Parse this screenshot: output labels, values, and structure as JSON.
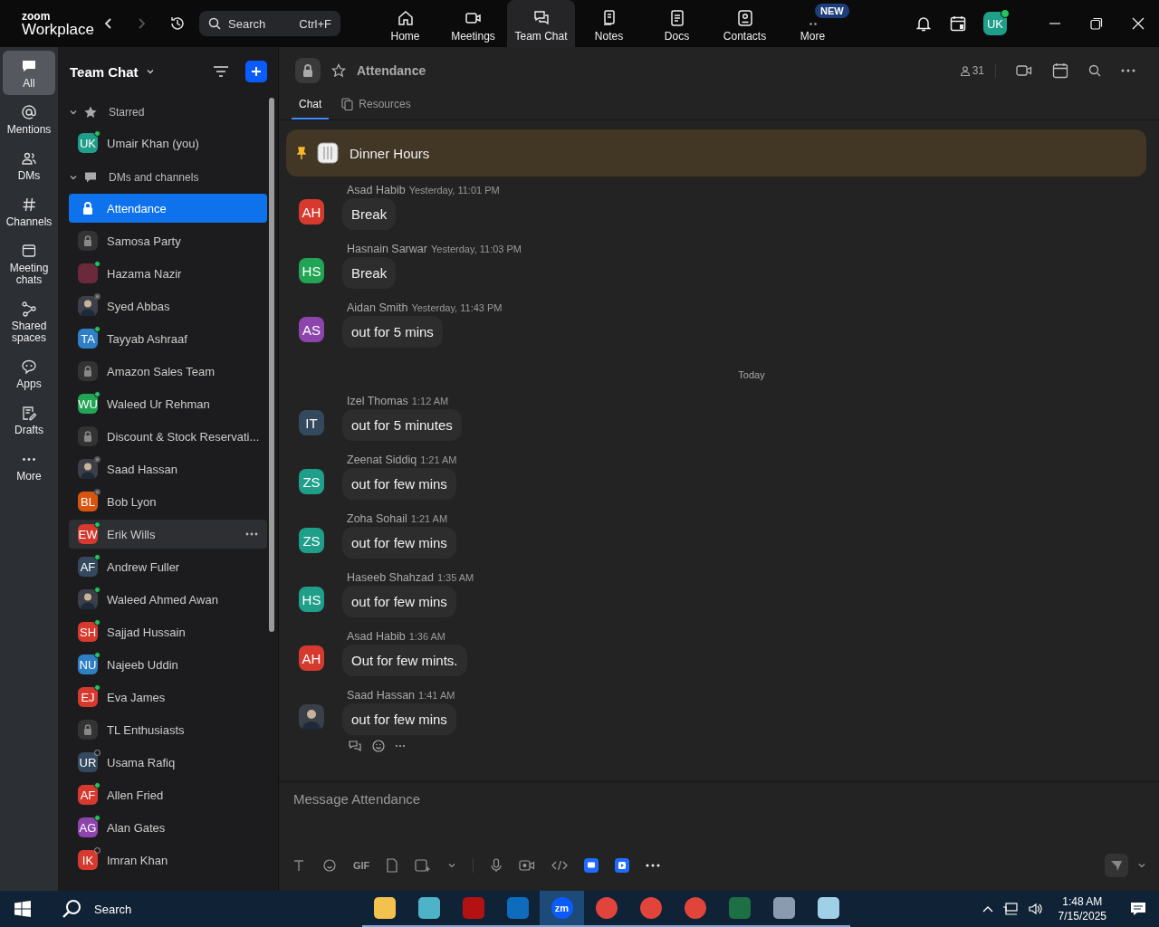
{
  "app": {
    "brand_small": "zoom",
    "brand": "Workplace",
    "search": {
      "placeholder": "Search",
      "shortcut": "Ctrl+F"
    }
  },
  "nav_tabs": [
    {
      "label": "Home",
      "kind": "home",
      "selected": false
    },
    {
      "label": "Meetings",
      "kind": "video",
      "selected": false
    },
    {
      "label": "Team Chat",
      "kind": "chat",
      "selected": true
    },
    {
      "label": "Notes",
      "kind": "notes",
      "selected": false
    },
    {
      "label": "Docs",
      "kind": "doc",
      "selected": false
    },
    {
      "label": "Contacts",
      "kind": "contact",
      "selected": false
    },
    {
      "label": "More",
      "kind": "more",
      "selected": false,
      "badge": "NEW"
    }
  ],
  "user": {
    "initials": "UK",
    "online": true
  },
  "rail": [
    {
      "label": "All",
      "kind": "chat",
      "selected": true
    },
    {
      "label": "Mentions",
      "kind": "at",
      "selected": false
    },
    {
      "label": "DMs",
      "kind": "people",
      "selected": false
    },
    {
      "label": "Channels",
      "kind": "hash",
      "selected": false
    },
    {
      "label": "Meeting chats",
      "kind": "calendar",
      "selected": false
    },
    {
      "label": "Shared spaces",
      "kind": "share",
      "selected": false
    },
    {
      "label": "Apps",
      "kind": "bubble",
      "selected": false
    },
    {
      "label": "Drafts",
      "kind": "draft",
      "selected": false
    },
    {
      "label": "More",
      "kind": "dots",
      "selected": false
    }
  ],
  "sidebar": {
    "title": "Team Chat",
    "sections": [
      {
        "label": "Starred",
        "kind": "star",
        "expanded": true,
        "items": [
          {
            "name": "Umair Khan (you)",
            "kind": "initials",
            "initials": "UK",
            "color": "#1f9e89",
            "online": true,
            "away": false,
            "selected": false,
            "hovered": false
          }
        ]
      },
      {
        "label": "DMs and channels",
        "kind": "bubble",
        "expanded": true,
        "items": [
          {
            "name": "Attendance",
            "kind": "lock",
            "selected": true,
            "hovered": false
          },
          {
            "name": "Samosa Party",
            "kind": "lock",
            "selected": false,
            "hovered": false
          },
          {
            "name": "Hazama Nazir",
            "kind": "initials",
            "color": "#6b2a3c",
            "online": true,
            "away": false,
            "selected": false,
            "hovered": false
          },
          {
            "name": "Syed Abbas",
            "kind": "photo",
            "online": false,
            "away": true,
            "selected": false,
            "hovered": false
          },
          {
            "name": "Tayyab Ashraaf",
            "kind": "initials",
            "initials": "TA",
            "color": "#2f7fc6",
            "online": true,
            "away": false,
            "selected": false,
            "hovered": false
          },
          {
            "name": "Amazon Sales Team",
            "kind": "lock",
            "selected": false,
            "hovered": false
          },
          {
            "name": "Waleed Ur Rehman",
            "kind": "initials",
            "initials": "WU",
            "color": "#22a455",
            "online": true,
            "away": false,
            "selected": false,
            "hovered": false
          },
          {
            "name": "Discount & Stock Reservati...",
            "kind": "lock",
            "selected": false,
            "hovered": false
          },
          {
            "name": "Saad Hassan",
            "kind": "photo",
            "online": false,
            "away": true,
            "selected": false,
            "hovered": false
          },
          {
            "name": "Bob Lyon",
            "kind": "initials",
            "initials": "BL",
            "color": "#d9540f",
            "online": false,
            "away": true,
            "selected": false,
            "hovered": false
          },
          {
            "name": "Erik Wills",
            "kind": "initials",
            "initials": "EW",
            "color": "#d63a2f",
            "online": true,
            "away": false,
            "selected": false,
            "hovered": true
          },
          {
            "name": "Andrew Fuller",
            "kind": "initials",
            "initials": "AF",
            "color": "#34495e",
            "online": true,
            "away": false,
            "selected": false,
            "hovered": false
          },
          {
            "name": "Waleed Ahmed Awan",
            "kind": "photo",
            "online": true,
            "away": false,
            "selected": false,
            "hovered": false
          },
          {
            "name": "Sajjad Hussain",
            "kind": "initials",
            "initials": "SH",
            "color": "#d63a2f",
            "online": true,
            "away": false,
            "selected": false,
            "hovered": false
          },
          {
            "name": "Najeeb Uddin",
            "kind": "initials",
            "initials": "NU",
            "color": "#2f7fc6",
            "online": true,
            "away": false,
            "selected": false,
            "hovered": false
          },
          {
            "name": "Eva James",
            "kind": "initials",
            "initials": "EJ",
            "color": "#d63a2f",
            "online": true,
            "away": false,
            "selected": false,
            "hovered": false
          },
          {
            "name": "TL Enthusiasts",
            "kind": "lock",
            "selected": false,
            "hovered": false
          },
          {
            "name": "Usama Rafiq",
            "kind": "initials",
            "initials": "UR",
            "color": "#34495e",
            "online": false,
            "away": false,
            "selected": false,
            "hovered": false
          },
          {
            "name": "Allen Fried",
            "kind": "initials",
            "initials": "AF",
            "color": "#d63a2f",
            "online": true,
            "away": false,
            "selected": false,
            "hovered": false
          },
          {
            "name": "Alan Gates",
            "kind": "initials",
            "initials": "AG",
            "color": "#8e44ad",
            "online": true,
            "away": false,
            "selected": false,
            "hovered": false
          },
          {
            "name": "Imran Khan",
            "kind": "initials",
            "initials": "IK",
            "color": "#d63a2f",
            "online": false,
            "away": false,
            "selected": false,
            "hovered": false
          }
        ]
      }
    ]
  },
  "channel": {
    "title": "Attendance",
    "members": "31",
    "tabs": [
      {
        "label": "Chat",
        "kind": "chat",
        "selected": true
      },
      {
        "label": "Resources",
        "kind": "files",
        "selected": false
      }
    ],
    "pinned": "Dinner Hours",
    "messages": [
      {
        "kind": "message",
        "initials": "AH",
        "color": "#d63a2f",
        "sender": "Asad Habib",
        "time": "Yesterday, 11:01 PM",
        "text": "Break"
      },
      {
        "kind": "message",
        "initials": "HS",
        "color": "#22a455",
        "sender": "Hasnain Sarwar",
        "time": "Yesterday, 11:03 PM",
        "text": "Break"
      },
      {
        "kind": "message",
        "initials": "AS",
        "color": "#8e44ad",
        "sender": "Aidan Smith",
        "time": "Yesterday, 11:43 PM",
        "text": "out for 5 mins"
      },
      {
        "kind": "divider",
        "text": "Today"
      },
      {
        "kind": "message",
        "initials": "IT",
        "color": "#34495e",
        "sender": "Izel Thomas",
        "time": "1:12 AM",
        "text": "out for 5 minutes"
      },
      {
        "kind": "message",
        "initials": "ZS",
        "color": "#1f9e89",
        "sender": "Zeenat Siddiq",
        "time": "1:21 AM",
        "text": "out for few mins"
      },
      {
        "kind": "message",
        "initials": "ZS",
        "color": "#1f9e89",
        "sender": "Zoha Sohail",
        "time": "1:21 AM",
        "text": "out for few mins"
      },
      {
        "kind": "message",
        "initials": "HS",
        "color": "#1f9e89",
        "sender": "Haseeb Shahzad",
        "time": "1:35 AM",
        "text": "out for few mins"
      },
      {
        "kind": "message",
        "initials": "AH",
        "color": "#d63a2f",
        "sender": "Asad Habib",
        "time": "1:36 AM",
        "text": "Out for few mints."
      },
      {
        "kind": "message",
        "sender": "Saad Hassan",
        "time": "1:41 AM",
        "text": "out for few mins",
        "actions": true
      }
    ],
    "composer": {
      "placeholder": "Message Attendance",
      "gif": "GIF"
    }
  },
  "taskbar": {
    "search": "Search",
    "time": "1:48 AM",
    "date": "7/15/2025",
    "apps": [
      {
        "kind": "folder",
        "active": false
      },
      {
        "kind": "gem",
        "active": false
      },
      {
        "kind": "filezilla",
        "active": false
      },
      {
        "kind": "outlook",
        "active": false
      },
      {
        "kind": "zoom",
        "label": "zm",
        "active": true
      },
      {
        "kind": "chrome",
        "active": false
      },
      {
        "kind": "chrome",
        "active": false
      },
      {
        "kind": "chrome",
        "active": false
      },
      {
        "kind": "excel",
        "active": false
      },
      {
        "kind": "calculator",
        "active": false
      },
      {
        "kind": "notepad",
        "active": false
      }
    ]
  }
}
